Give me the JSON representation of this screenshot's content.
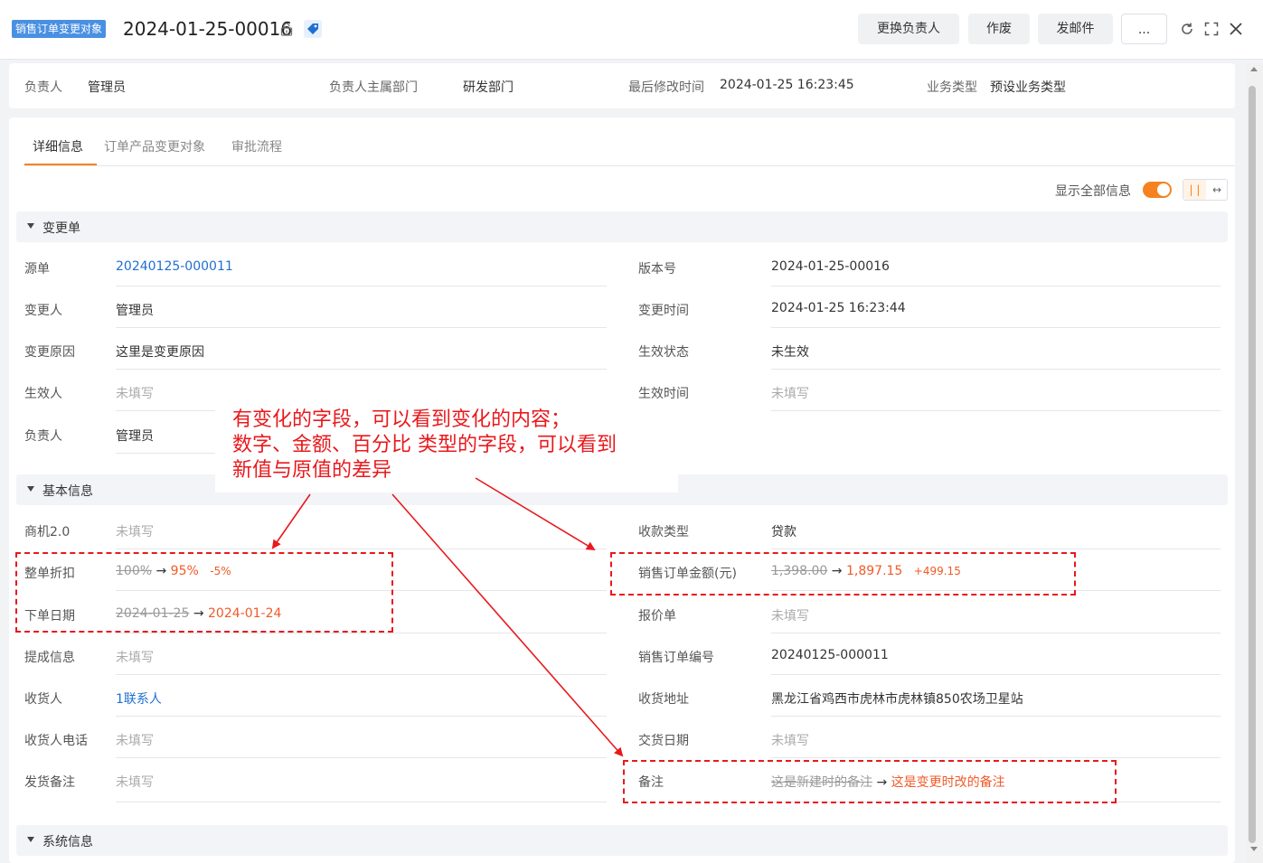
{
  "header": {
    "tag": "销售订单变更对象",
    "title": "2024-01-25-00016",
    "buttons": {
      "change_owner": "更换负责人",
      "void": "作废",
      "send_mail": "发邮件",
      "more": "..."
    }
  },
  "summary": [
    {
      "label": "负责人",
      "value": "管理员"
    },
    {
      "label": "负责人主属部门",
      "value": "研发部门"
    },
    {
      "label": "最后修改时间",
      "value": "2024-01-25 16:23:45"
    },
    {
      "label": "业务类型",
      "value": "预设业务类型"
    }
  ],
  "tabs": [
    "详细信息",
    "订单产品变更对象",
    "审批流程"
  ],
  "toggle": {
    "label": "显示全部信息",
    "on": true
  },
  "sections": {
    "change": {
      "title": "变更单",
      "left": [
        {
          "label": "源单",
          "value": "20240125-000011"
        },
        {
          "label": "变更人",
          "value": "管理员"
        },
        {
          "label": "变更原因",
          "value": "这里是变更原因"
        },
        {
          "label": "生效人",
          "value": "未填写"
        },
        {
          "label": "负责人",
          "value": "管理员"
        }
      ],
      "right": [
        {
          "label": "版本号",
          "value": "2024-01-25-00016"
        },
        {
          "label": "变更时间",
          "value": "2024-01-25 16:23:44"
        },
        {
          "label": "生效状态",
          "value": "未生效"
        },
        {
          "label": "生效时间",
          "value": "未填写"
        }
      ]
    },
    "basic": {
      "title": "基本信息",
      "left": [
        {
          "label": "商机2.0",
          "value": "未填写"
        },
        {
          "label": "整单折扣",
          "old": "100%",
          "new": "95%",
          "diff": "-5%"
        },
        {
          "label": "下单日期",
          "old": "2024-01-25",
          "new": "2024-01-24"
        },
        {
          "label": "提成信息",
          "value": "未填写"
        },
        {
          "label": "收货人",
          "value": "1联系人"
        },
        {
          "label": "收货人电话",
          "value": "未填写"
        },
        {
          "label": "发货备注",
          "value": "未填写"
        }
      ],
      "right": [
        {
          "label": "收款类型",
          "value": "贷款"
        },
        {
          "label": "销售订单金额(元)",
          "old": "1,398.00",
          "new": "1,897.15",
          "diff": "+499.15"
        },
        {
          "label": "报价单",
          "value": "未填写"
        },
        {
          "label": "销售订单编号",
          "value": "20240125-000011"
        },
        {
          "label": "收货地址",
          "value": "黑龙江省鸡西市虎林市虎林镇850农场卫星站"
        },
        {
          "label": "交货日期",
          "value": "未填写"
        },
        {
          "label": "备注",
          "old": "这是新建时的备注",
          "new": "这是变更时改的备注"
        }
      ]
    },
    "system": {
      "title": "系统信息"
    }
  },
  "annotation": {
    "lines": [
      "有变化的字段，可以看到变化的内容；",
      "数字、金额、百分比 类型的字段，可以看到",
      "新值与原值的差异"
    ]
  },
  "colors": {
    "accent": "#f5821f",
    "tag": "#4a90e2",
    "link": "#1f6fd1",
    "changed": "#f05a28",
    "annotation": "#e8191d"
  }
}
